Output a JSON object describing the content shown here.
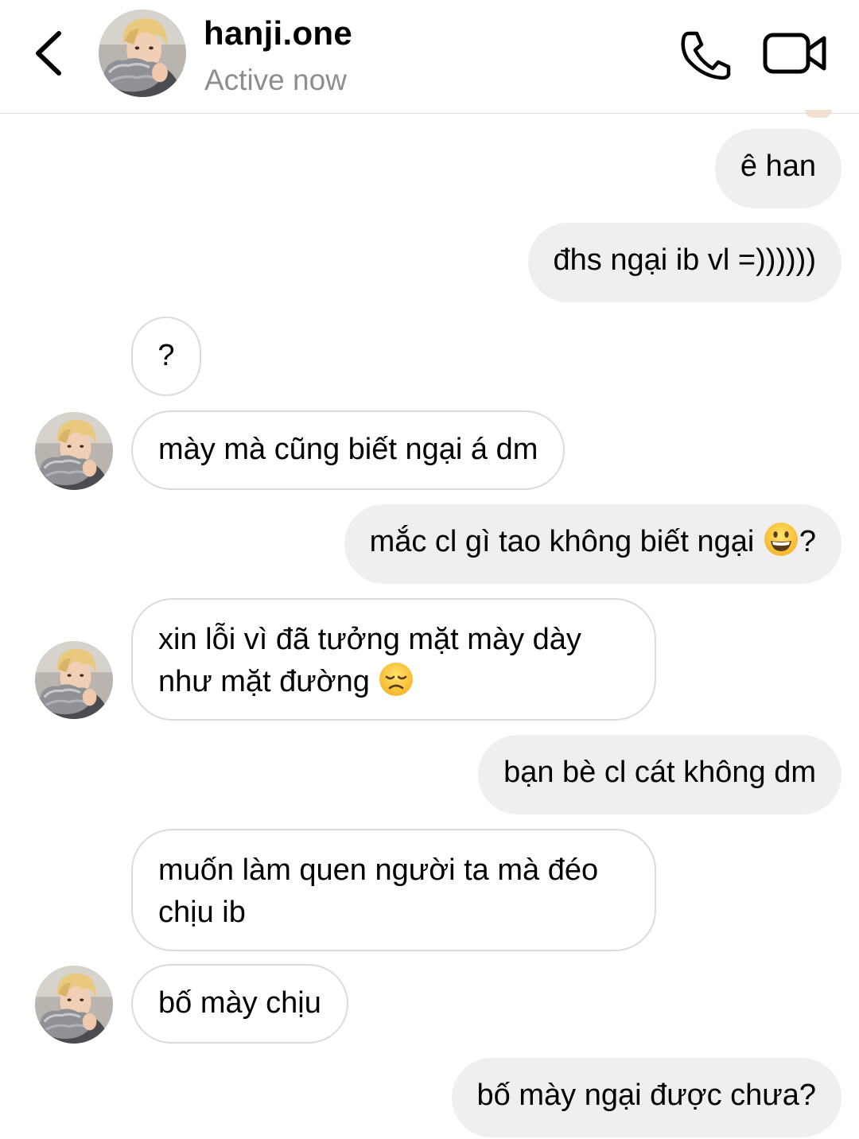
{
  "header": {
    "back_icon": "chevron-left-icon",
    "username": "hanji.one",
    "status": "Active now",
    "call_icon": "phone-icon",
    "video_icon": "video-camera-icon"
  },
  "messages": [
    {
      "sender": "me",
      "text": "ê han"
    },
    {
      "sender": "me",
      "text": "đhs ngại ib vl =))))))"
    },
    {
      "sender": "them",
      "text": "?"
    },
    {
      "sender": "them",
      "text": "mày mà cũng biết ngại á dm"
    },
    {
      "sender": "me",
      "text": "mắc cl gì tao không biết ngại ",
      "suffix": "?",
      "emoji": "grinning-face"
    },
    {
      "sender": "them",
      "line1": "xin lỗi vì đã tưởng mặt mày dày",
      "line2": "như mặt đường ",
      "emoji": "disappointed-face"
    },
    {
      "sender": "me",
      "text": "bạn bè cl cát không dm"
    },
    {
      "sender": "them",
      "line1": "muốn làm quen người ta mà đéo",
      "line2": "chịu ib"
    },
    {
      "sender": "them",
      "text": "bố mày chịu"
    },
    {
      "sender": "me",
      "text": "bố mày ngại được chưa?"
    }
  ]
}
